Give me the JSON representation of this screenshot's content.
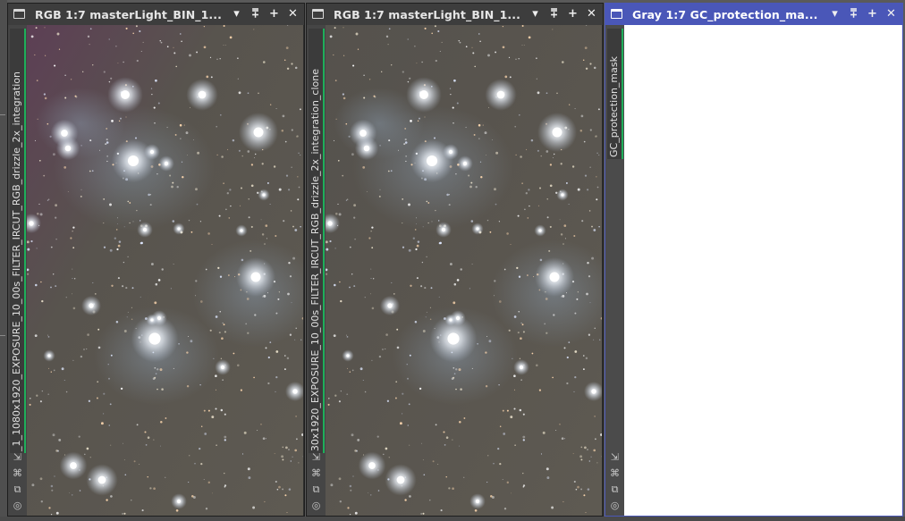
{
  "windows": [
    {
      "title": "RGB 1:7 masterLight_BIN_1...",
      "identifier": "_1_1080x1920_EXPOSURE_10_00s_FILTER_IRCUT_RGB_drizzle_2x_integration",
      "kind": "rgb",
      "active": false
    },
    {
      "title": "RGB 1:7 masterLight_BIN_1...",
      "identifier": "30x1920_EXPOSURE_10_00s_FILTER_IRCUT_RGB_drizzle_2x_integration_clone",
      "kind": "rgb",
      "active": false
    },
    {
      "title": "Gray 1:7 GC_protection_ma...",
      "identifier": "GC_protection_mask",
      "kind": "gray",
      "active": true
    }
  ],
  "titlebar_buttons": [
    {
      "name": "shade-button",
      "icon": "shade-icon",
      "glyph": "▾"
    },
    {
      "name": "minimize-button",
      "icon": "minimize-icon",
      "glyph": "⩱"
    },
    {
      "name": "maximize-button",
      "icon": "maximize-icon",
      "glyph": "+"
    },
    {
      "name": "close-button",
      "icon": "close-icon",
      "glyph": "✕"
    }
  ],
  "side_tools": [
    {
      "name": "shrink-tool",
      "icon": "diagonal-arrow-icon",
      "glyph": "⇲"
    },
    {
      "name": "fit-tool",
      "icon": "fit-view-icon",
      "glyph": "⌘"
    },
    {
      "name": "clone-tool",
      "icon": "duplicate-icon",
      "glyph": "⧉"
    },
    {
      "name": "target-tool",
      "icon": "target-icon",
      "glyph": "◎"
    }
  ],
  "colors": {
    "active_titlebar": "#4a57b8",
    "inactive_titlebar": "#3d3d3d",
    "tab_accent": "#1fae5a",
    "mask_background": "#ffffff",
    "sky_background": "#5b574f"
  }
}
